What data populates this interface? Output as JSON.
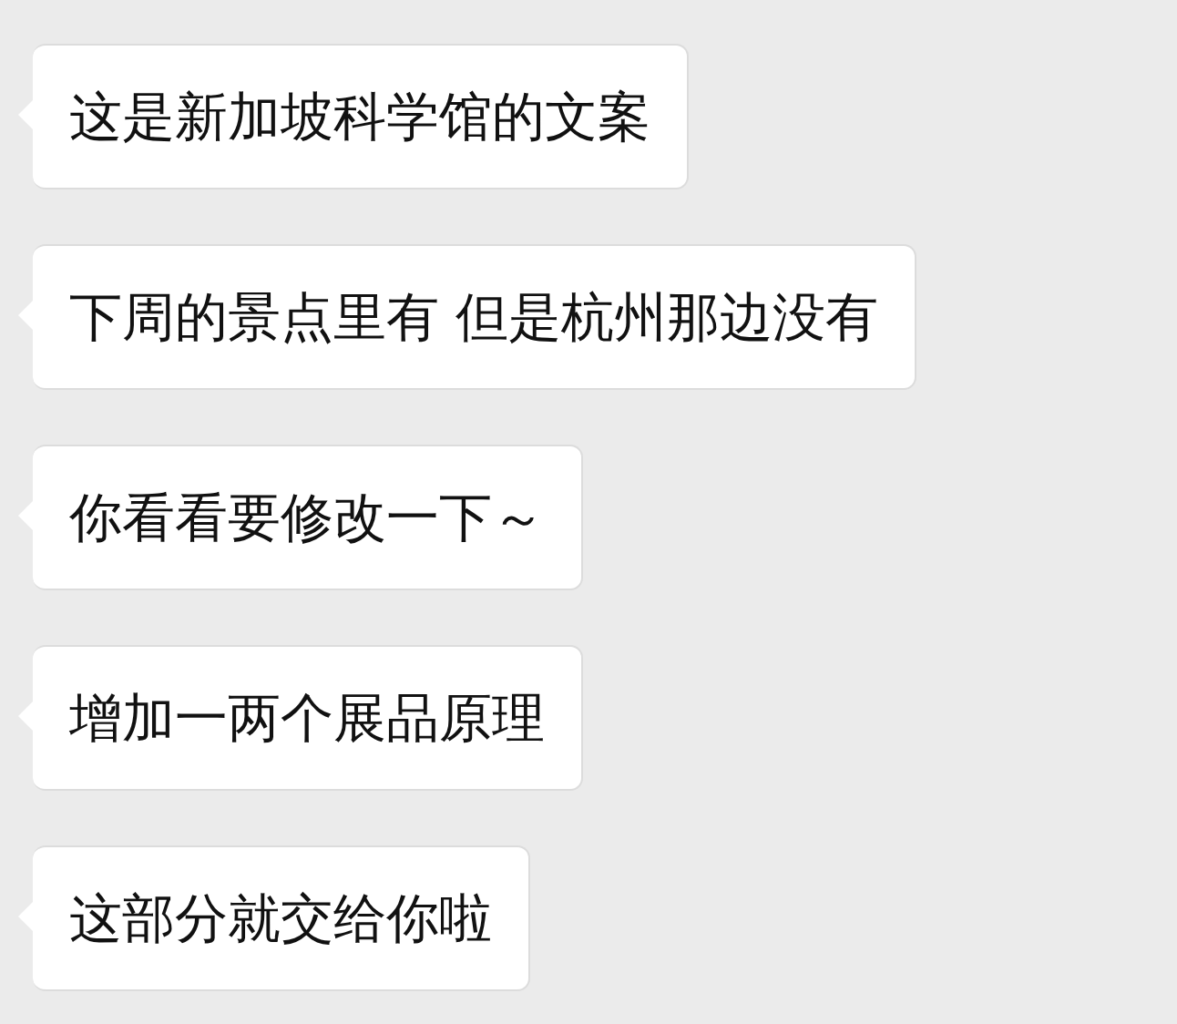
{
  "messages": [
    {
      "text": "这是新加坡科学馆的文案"
    },
    {
      "text": "下周的景点里有 但是杭州那边没有"
    },
    {
      "text": "你看看要修改一下～"
    },
    {
      "text": "增加一两个展品原理"
    },
    {
      "text": "这部分就交给你啦"
    }
  ]
}
